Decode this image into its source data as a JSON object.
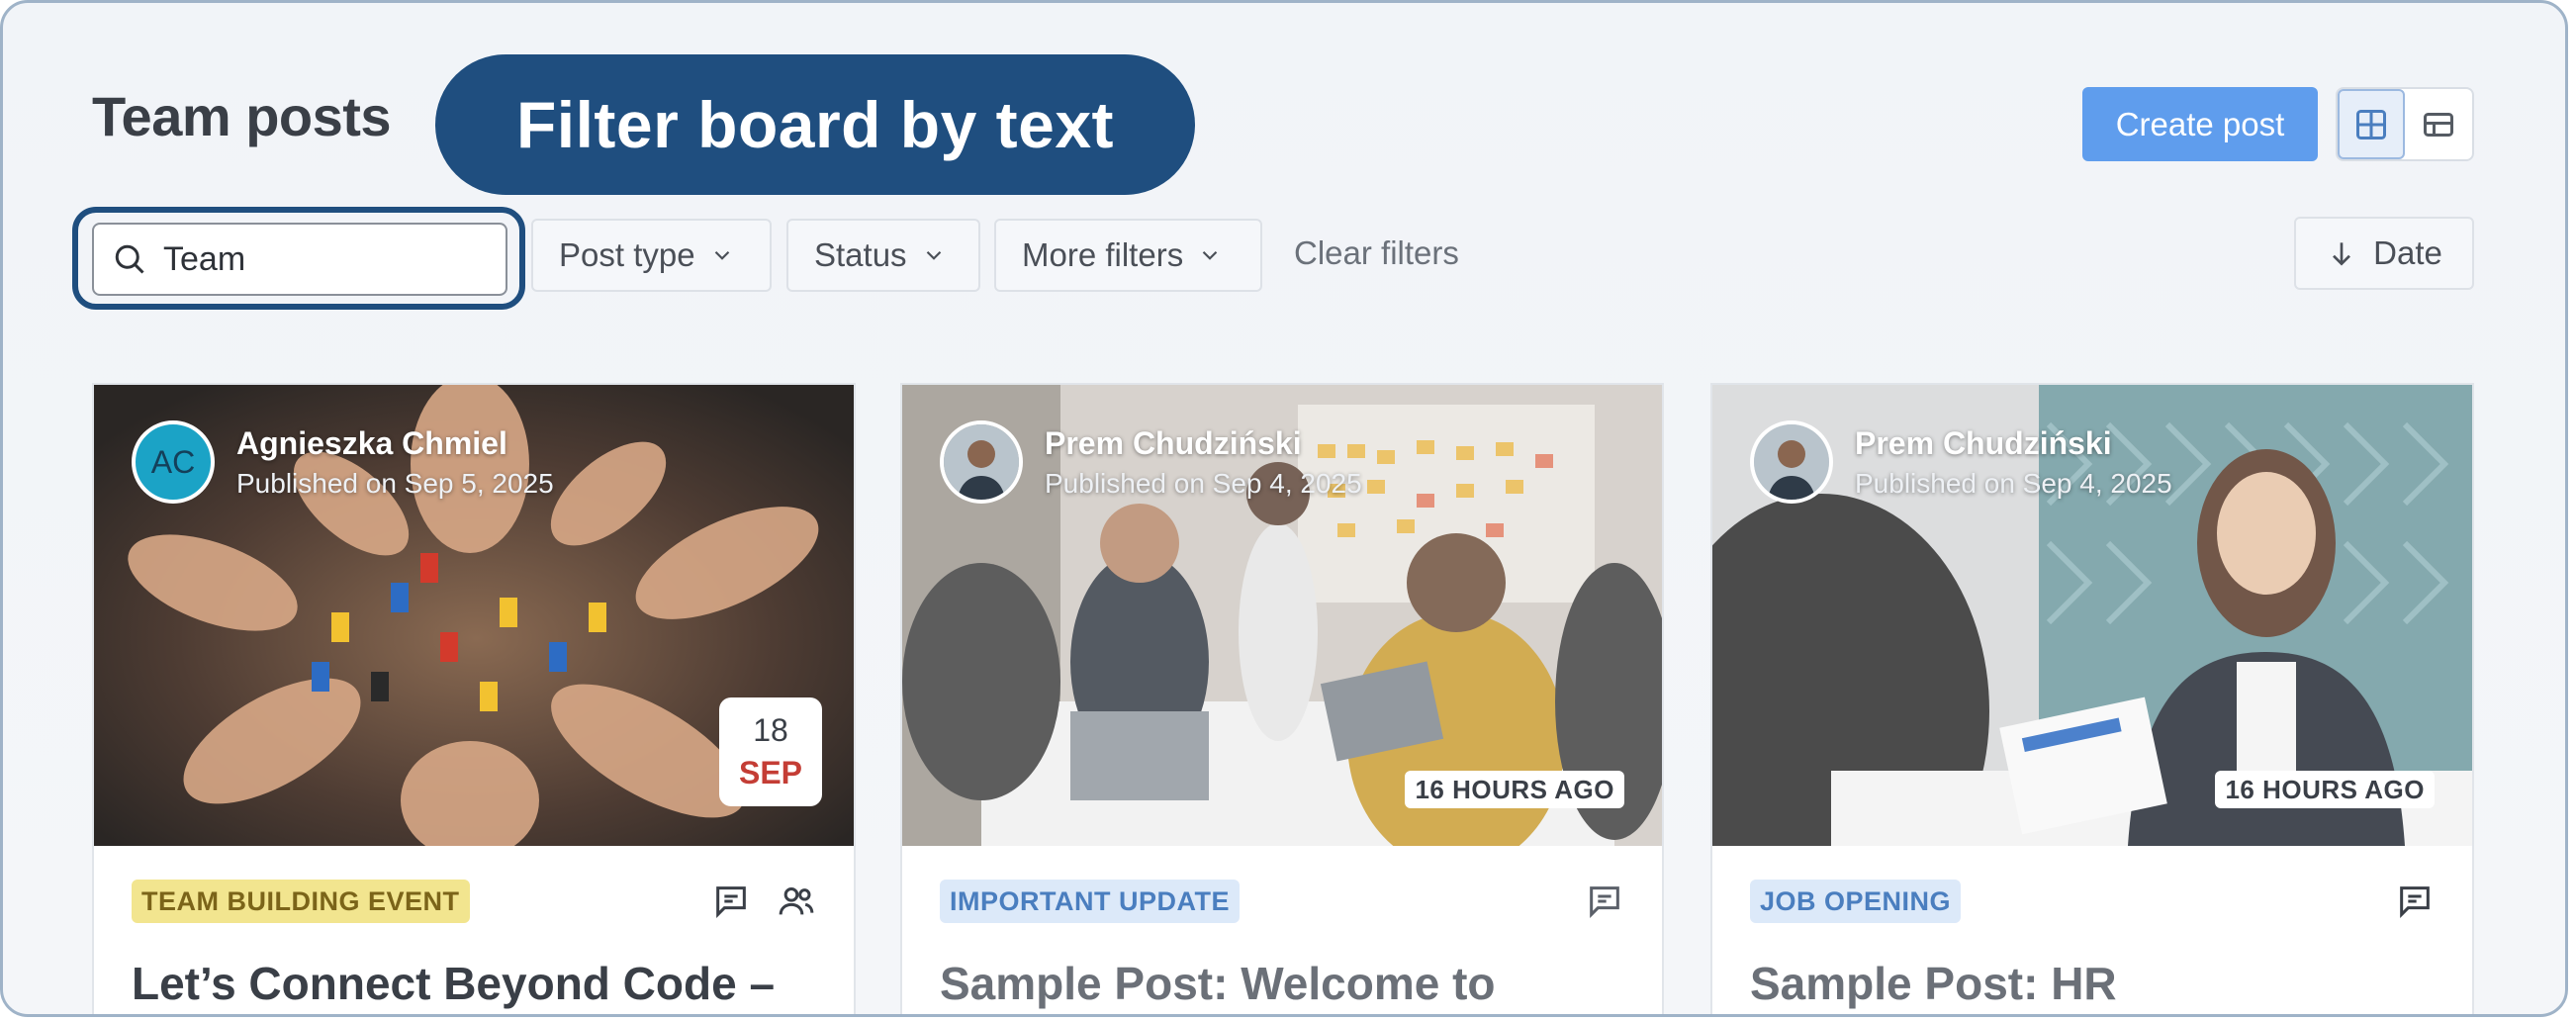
{
  "header": {
    "title": "Team posts",
    "callout": "Filter board by text",
    "create_label": "Create post"
  },
  "search": {
    "value": "Team"
  },
  "filters": {
    "post_type": "Post type",
    "status": "Status",
    "more": "More filters",
    "clear": "Clear filters",
    "sort": "Date"
  },
  "cards": [
    {
      "author": "Agnieszka Chmiel",
      "initials": "AC",
      "published": "Published on Sep 5, 2025",
      "date_day": "18",
      "date_month": "SEP",
      "tag": "TEAM BUILDING EVENT",
      "title": "Let’s Connect Beyond Code –"
    },
    {
      "author": "Prem Chudziński",
      "published": "Published on Sep 4, 2025",
      "ago": "16 HOURS AGO",
      "tag": "IMPORTANT UPDATE",
      "title": "Sample Post: Welcome to"
    },
    {
      "author": "Prem Chudziński",
      "published": "Published on Sep 4, 2025",
      "ago": "16 HOURS AGO",
      "tag": "JOB OPENING",
      "title": "Sample Post: HR"
    }
  ],
  "colors": {
    "accent": "#5f9ded",
    "callout": "#1f4e7f",
    "tag_yellow": "#f2e58f",
    "tag_blue": "#dce9f9"
  }
}
